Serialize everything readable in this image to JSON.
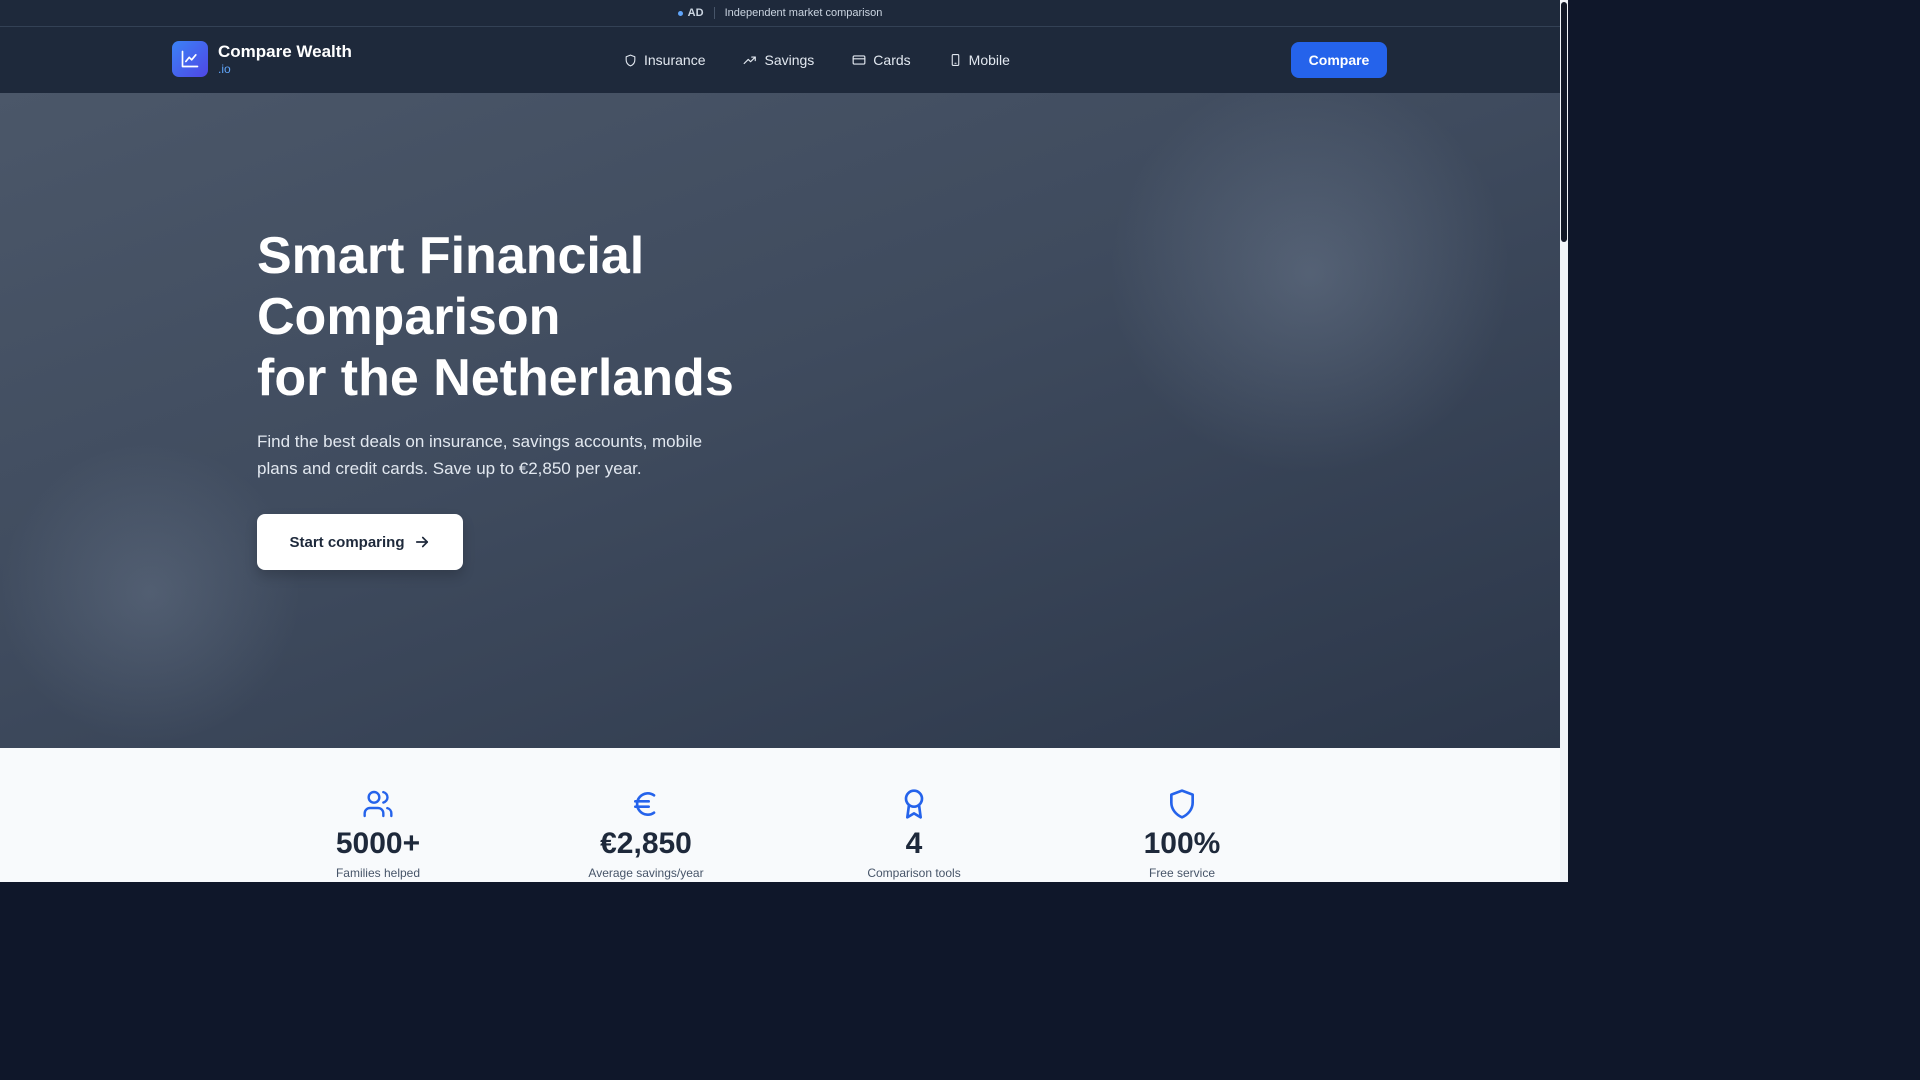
{
  "adbar": {
    "badge": "AD",
    "text": "Independent market comparison"
  },
  "header": {
    "brand_title": "Compare Wealth",
    "brand_sub": ".io",
    "nav": [
      {
        "label": "Insurance",
        "icon": "shield-icon"
      },
      {
        "label": "Savings",
        "icon": "trending-up-icon"
      },
      {
        "label": "Cards",
        "icon": "credit-card-icon"
      },
      {
        "label": "Mobile",
        "icon": "smartphone-icon"
      }
    ],
    "cta_label": "Compare"
  },
  "hero": {
    "title_lines": [
      "Smart Financial",
      "Comparison",
      "for the Netherlands"
    ],
    "description": "Find the best deals on insurance, savings accounts, mobile plans and credit cards. Save up to €2,850 per year.",
    "button_label": "Start comparing"
  },
  "stats": [
    {
      "icon": "users-icon",
      "value": "5000+",
      "label": "Families helped"
    },
    {
      "icon": "euro-icon",
      "value": "€2,850",
      "label": "Average savings/year"
    },
    {
      "icon": "award-icon",
      "value": "4",
      "label": "Comparison tools"
    },
    {
      "icon": "shield-icon",
      "value": "100%",
      "label": "Free service"
    }
  ],
  "colors": {
    "accent": "#2563eb",
    "header_bg": "#1e293b",
    "brand_sub": "#60a5fa",
    "stats_bg": "#f8fafc"
  }
}
